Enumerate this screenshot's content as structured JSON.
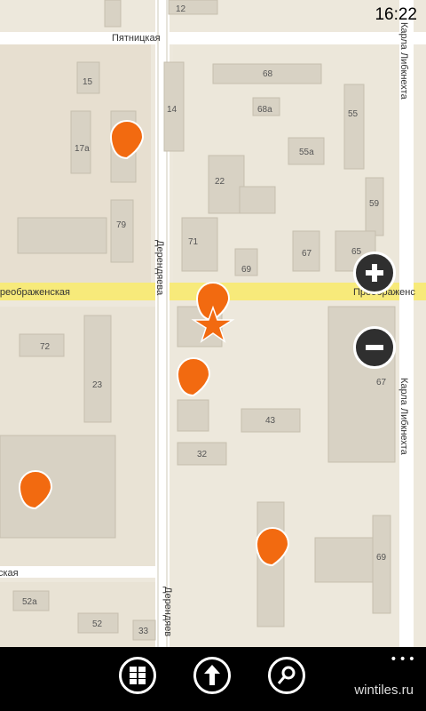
{
  "status_bar": {
    "time": "16:22"
  },
  "map": {
    "streets": {
      "pyatnitskaya": "Пятницкая",
      "karla_libknekhta_top": "Карла Либкнехта",
      "karla_libknekhta_right": "Карла Либкнехта",
      "derendyaeva_mid": "Дерендяева",
      "derendyaeva_bottom": "Дерендяев",
      "preobrazhenskaya_left": "Преображенская",
      "preobrazhenskaya_right": "Преображенс",
      "bottom_left": "ская"
    },
    "buildings": [
      "12",
      "15",
      "17а",
      "68",
      "68а",
      "14",
      "55",
      "55а",
      "22",
      "59",
      "79",
      "71",
      "67",
      "65",
      "69",
      "72",
      "23",
      "43",
      "32",
      "67",
      "69",
      "52а",
      "52",
      "33"
    ],
    "pins": [
      "pin",
      "pin",
      "pin",
      "pin",
      "pin"
    ],
    "current_location": "star-marker"
  },
  "controls": {
    "zoom_in": "+",
    "zoom_out": "−"
  },
  "app_bar": {
    "buttons": [
      "grid-icon",
      "direction-arrow-icon",
      "search-icon"
    ],
    "more": "•••",
    "watermark": "wintiles.ru"
  },
  "colors": {
    "map_background": "#ede8dc",
    "building": "#d9d3c5",
    "pin": "#f26a10",
    "road_major": "#f7ea7a",
    "app_bar": "#000000"
  }
}
